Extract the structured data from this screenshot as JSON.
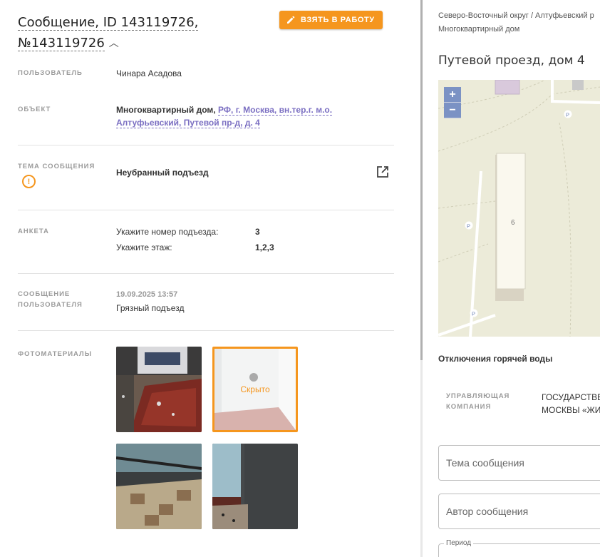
{
  "header": {
    "title": "Сообщение, ID 143119726, №143119726",
    "take_button": "ВЗЯТЬ В РАБОТУ"
  },
  "fields": {
    "user_label": "ПОЛЬЗОВАТЕЛЬ",
    "user_value": "Чинара Асадова",
    "object_label": "ОБЪЕКТ",
    "object_type": "Многоквартирный дом,",
    "object_address_line1": "РФ, г. Москва, вн.тер.г. м.о.",
    "object_address_line2": "Алтуфьевский, Путевой пр-д, д. 4",
    "topic_label": "ТЕМА СООБЩЕНИЯ",
    "topic_value": "Неубранный подъезд",
    "survey_label": "АНКЕТА",
    "survey": [
      {
        "q": "Укажите номер подъезда:",
        "a": "3"
      },
      {
        "q": "Укажите этаж:",
        "a": "1,2,3"
      }
    ],
    "message_label_line1": "СООБЩЕНИЕ",
    "message_label_line2": "ПОЛЬЗОВАТЕЛЯ",
    "message_date": "19.09.2025 13:57",
    "message_text": "Грязный подъезд",
    "photos_label": "ФОТОМАТЕРИАЛЫ",
    "hidden_label": "Скрыто"
  },
  "right": {
    "breadcrumb_line1": "Северо-Восточный округ / Алтуфьевский р",
    "breadcrumb_line2": "Многоквартирный дом",
    "address": "Путевой проезд, дом 4",
    "map_building_number": "6",
    "map_zoom_in": "+",
    "map_zoom_out": "−",
    "parking": "P",
    "hot_water": "Отключения горячей воды",
    "company_label_line1": "УПРАВЛЯЮЩАЯ",
    "company_label_line2": "КОМПАНИЯ",
    "company_value_line1": "ГОСУДАРСТВЕН",
    "company_value_line2": "МОСКВЫ «ЖИЛ",
    "topic_field": "Тема сообщения",
    "author_field": "Автор сообщения",
    "period_label": "Период"
  },
  "colors": {
    "accent": "#f5961e",
    "link": "#7b6fc2",
    "map_zoom": "#7b92c4"
  }
}
